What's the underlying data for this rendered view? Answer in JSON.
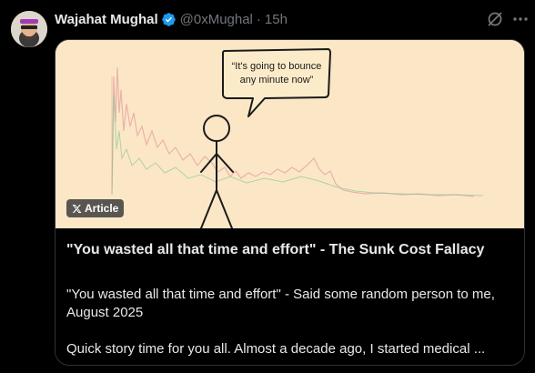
{
  "tweet": {
    "author_name": "Wajahat Mughal",
    "handle": "@0xMughal",
    "separator": "·",
    "time": "15h",
    "verified": true
  },
  "article": {
    "badge": "Article",
    "bubble_line1": "“It's going to bounce",
    "bubble_line2": "any minute now”",
    "title": "\"You wasted all that time and effort\" - The Sunk Cost Fallacy",
    "description_1": "\"You wasted all that time and effort\" - Said some random person to me, August 2025",
    "description_2": "Quick story time for you all. Almost a decade ago, I started medical ..."
  },
  "colors": {
    "background": "#000000",
    "verified_blue": "#1d9bf0",
    "card_image_bg": "#fbe7c6",
    "chart_line_red": "#e06c6c",
    "chart_line_green": "#6cbf7a"
  },
  "icons": [
    "verified-badge-icon",
    "grok-icon",
    "more-options-icon",
    "x-logo-icon"
  ]
}
